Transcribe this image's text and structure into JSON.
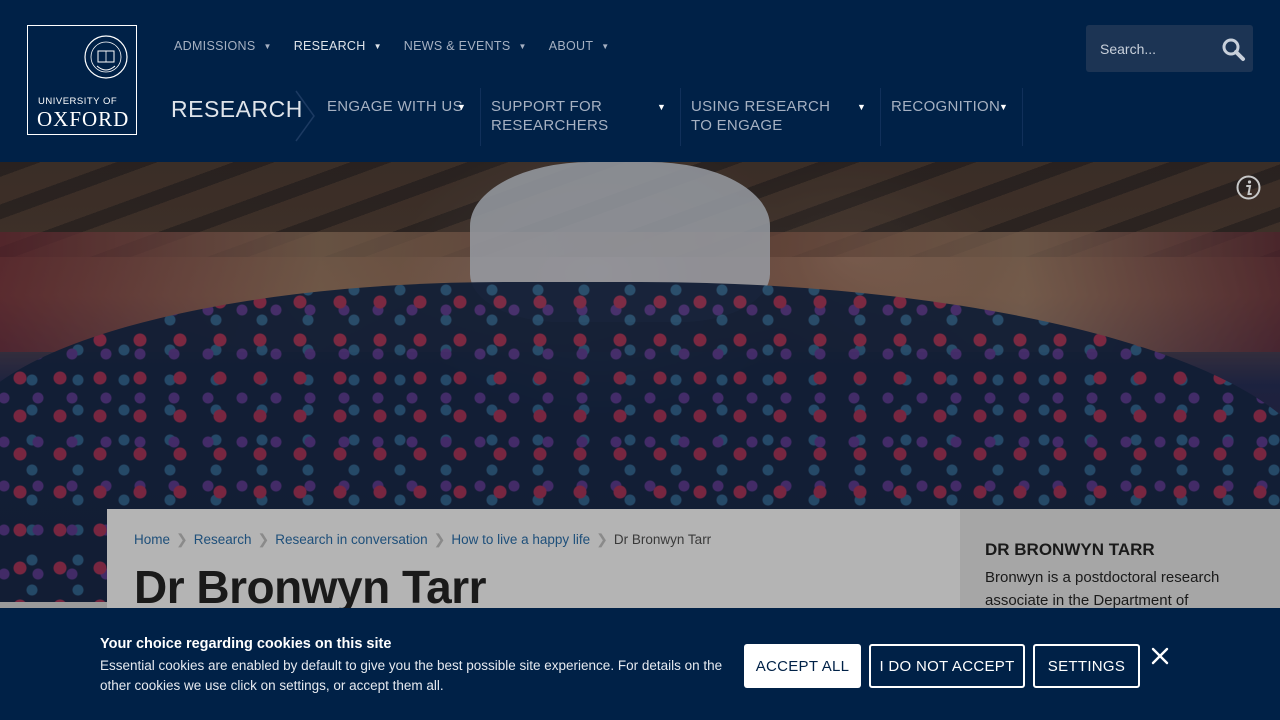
{
  "logo": {
    "line1": "UNIVERSITY OF",
    "line2": "OXFORD"
  },
  "topnav": [
    {
      "label": "ADMISSIONS",
      "active": false
    },
    {
      "label": "RESEARCH",
      "active": true
    },
    {
      "label": "NEWS & EVENTS",
      "active": false
    },
    {
      "label": "ABOUT",
      "active": false
    }
  ],
  "search": {
    "placeholder": "Search..."
  },
  "section": {
    "title": "RESEARCH"
  },
  "subnav": [
    {
      "label": "ENGAGE WITH US"
    },
    {
      "label": "SUPPORT FOR RESEARCHERS"
    },
    {
      "label": "USING RESEARCH TO ENGAGE"
    },
    {
      "label": "RECOGNITION"
    }
  ],
  "breadcrumb": {
    "items": [
      "Home",
      "Research",
      "Research in conversation",
      "How to live a happy life"
    ],
    "current": "Dr Bronwyn Tarr"
  },
  "page": {
    "title": "Dr Bronwyn Tarr"
  },
  "sidebar": {
    "title": "DR BRONWYN TARR",
    "text": "Bronwyn is a postdoctoral research associate in the Department of"
  },
  "cookie": {
    "title": "Your choice regarding cookies on this site",
    "text": "Essential cookies are enabled by default to give you the best possible site experience. For details on the other cookies we use click on settings, or accept them all.",
    "accept_label": "ACCEPT ALL",
    "decline_label": "I DO NOT ACCEPT",
    "settings_label": "SETTINGS"
  },
  "colors": {
    "brand": "#002147",
    "link": "#1e4f7a"
  }
}
